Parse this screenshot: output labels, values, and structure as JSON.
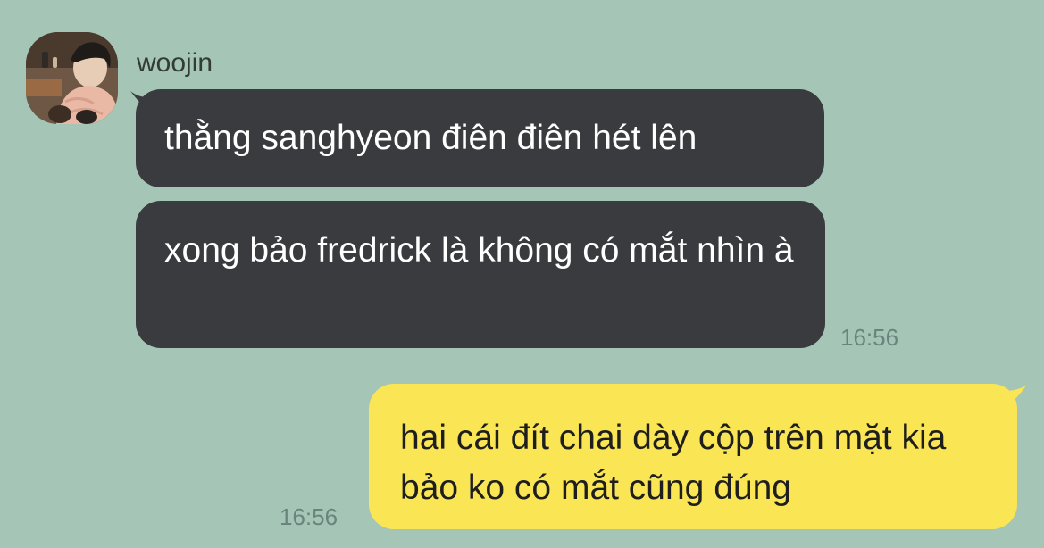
{
  "chat": {
    "incoming": {
      "sender_name": "woojin",
      "avatar_icon": "profile-photo-avatar",
      "messages": [
        {
          "text": "thằng sanghyeon điên điên hét lên"
        },
        {
          "text": "xong bảo fredrick là không có mắt nhìn à"
        }
      ],
      "time": "16:56"
    },
    "outgoing": {
      "messages": [
        {
          "text": "hai cái đít chai dày cộp trên mặt kia bảo ko có mắt cũng đúng"
        }
      ],
      "time": "16:56"
    }
  },
  "colors": {
    "background": "#a5c5b6",
    "incoming_bubble": "#3a3b3e",
    "outgoing_bubble": "#fae554",
    "timestamp": "#69857b"
  }
}
